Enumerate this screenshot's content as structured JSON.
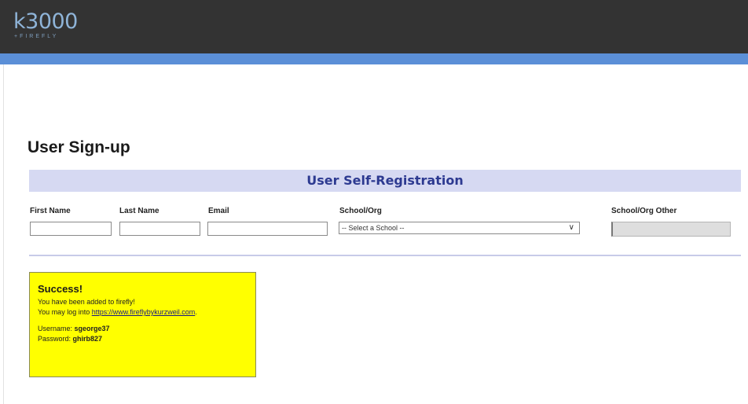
{
  "header": {
    "logo_main": "k3000",
    "logo_sub": "+FIREFLY"
  },
  "page": {
    "title": "User Sign-up"
  },
  "section": {
    "title": "User Self-Registration"
  },
  "form": {
    "first_name": {
      "label": "First Name",
      "value": ""
    },
    "last_name": {
      "label": "Last Name",
      "value": ""
    },
    "email": {
      "label": "Email",
      "value": ""
    },
    "school": {
      "label": "School/Org",
      "selected": "-- Select a School --"
    },
    "school_other": {
      "label": "School/Org Other",
      "value": ""
    }
  },
  "success": {
    "title": "Success!",
    "line1": "You have been added to firefly!",
    "line2_prefix": "You may log into ",
    "link": "https://www.fireflybykurzweil.com",
    "line2_suffix": ".",
    "username_label": "Username: ",
    "username": "sgeorge37",
    "password_label": "Password: ",
    "password": "ghirb827"
  },
  "colors": {
    "header_bg": "#333333",
    "accent_bar": "#5b8fd7",
    "section_bg": "#d6d9f2",
    "section_text": "#2d3a91",
    "success_bg": "#ffff00"
  },
  "icons": {
    "select_caret": "chevron-down-icon"
  }
}
